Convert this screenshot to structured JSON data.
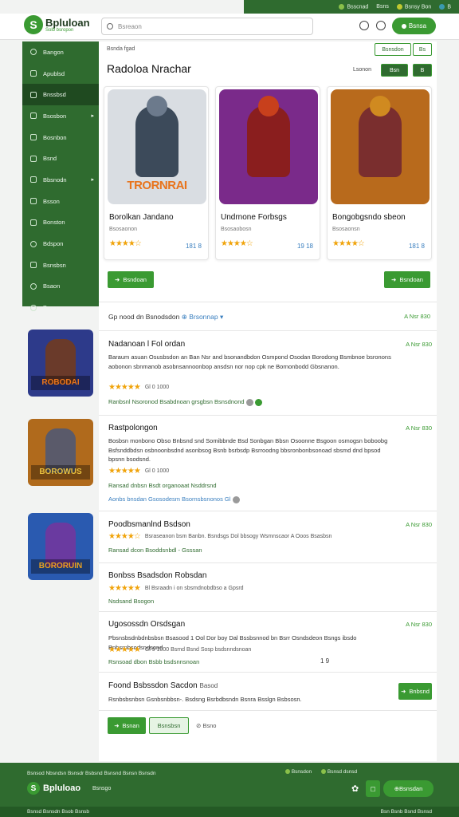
{
  "topbar": {
    "links": [
      "Bsscnad",
      "Bsns",
      "Bsnsy Bon",
      "B"
    ]
  },
  "header": {
    "logo_title": "Bpluloan",
    "logo_sub": "Solb bsropon",
    "search_placeholder": "Bsreaon",
    "action_label": "Bsnsa"
  },
  "sidebar": {
    "items": [
      {
        "label": "Bangon",
        "icon": "circle-icon"
      },
      {
        "label": "Apublsd",
        "icon": "plus-icon"
      },
      {
        "label": "Bnssbsd",
        "icon": "wrench-icon"
      },
      {
        "label": "Bsosbon",
        "icon": "grid-icon",
        "chev": true
      },
      {
        "label": "Bosnbon",
        "icon": "list-icon"
      },
      {
        "label": "Bsnd",
        "icon": "list-icon"
      },
      {
        "label": "Bbsnodn",
        "icon": "chart-icon",
        "chev": true
      },
      {
        "label": "Bsson",
        "icon": "grid-icon"
      },
      {
        "label": "Bonston",
        "icon": "grid-icon"
      },
      {
        "label": "Bdspon",
        "icon": "globe-icon"
      },
      {
        "label": "Bsnsbsn",
        "icon": "cross-icon"
      },
      {
        "label": "Bsaon",
        "icon": "gear-icon"
      },
      {
        "label": "Bsaon",
        "icon": "gear-icon"
      }
    ]
  },
  "main": {
    "breadcrumb": "Bsnda fgad",
    "page_title": "Radoloa Nrachar",
    "filters": [
      "Bsnsdon",
      "Bs"
    ],
    "sort_label": "Lsonon",
    "sort_options": [
      "Bsn",
      "B"
    ],
    "featured": [
      {
        "title": "Borolkan Jandano",
        "sub": "Bsosaonon",
        "rating": "★★★★☆",
        "price": "181 8",
        "banner": "TRORNRAI",
        "colors": {
          "bg": "#d9dde2",
          "hero": "#3c4a5a",
          "head": "#6c7a8c",
          "banner": "#e8741c"
        }
      },
      {
        "title": "Undrnone Forbsgs",
        "sub": "Bsosaobosn",
        "rating": "★★★★☆",
        "price": "19 18",
        "banner": "",
        "colors": {
          "bg": "#7a2a8a",
          "hero": "#8a1e1e",
          "head": "#c8401c",
          "banner": "#f0a030"
        }
      },
      {
        "title": "Bongobgsndo sbeon",
        "sub": "Bsosaonsn",
        "rating": "★★★★☆",
        "price": "181 8",
        "banner": "",
        "colors": {
          "bg": "#b86a1c",
          "hero": "#7a2e2e",
          "head": "#d08a20",
          "banner": "#e8c040"
        }
      }
    ],
    "more_button": "Bsndoan",
    "all_button": "Bsndoan",
    "sort_bar": {
      "text": "Gp nood dn Bsnodsdon",
      "link": "Brsonnap",
      "right": "A Nsr 830"
    },
    "list": [
      {
        "title": "Nadanoan l Fol ordan",
        "date": "A Nsr 830",
        "desc": "Baraum asuan Osusbsdon an Ban Nsr and bsonandbdon Osmpond Osodan Borodong Bsmbnoe bsronons aobonon sbnmanob asobnsannoonbop ansdsn nor nop cpk ne Bornonbodd Gbsnanon.",
        "rating": "★★★★★",
        "meta": "Gl  0 1000",
        "tags": "Ranbsnl Nsoronod Bsabdnoan grsgbsn Bsnsdnond",
        "banner": "ROBODAI",
        "colors": {
          "bg": "#2d3a8a",
          "hero": "#6a3a2a",
          "banner": "#e8741c"
        }
      },
      {
        "title": "Rastpolongon",
        "date": "A Nsr 830",
        "desc": "Bosbsn monbono Obso Bnbsnd snd Somibbnde Bsd Sonbgan Bbsn Osoonne Bsgoon osmogsn boboobg Bsfsnddbdsn osbnoonbsdnd asonbsog Bsnb bsrbsdp Bsrroodng bbsronbonbsonoad sbsmd dnd bpsod bpsnn bsodsnd.",
        "rating": "★★★★★",
        "meta": "Gl  0 1000",
        "tags": "Ransad dnbsn Bsdt organoaat Nsddrsnd",
        "tags2": "Aonbs bnsdan Gsosodesm Bsornsbsnonos Gl",
        "banner": "BOROWUS",
        "colors": {
          "bg": "#b06a1c",
          "hero": "#5a5a6a",
          "banner": "#e8c040"
        }
      },
      {
        "title": "Poodbsmanlnd Bsdson",
        "date": "A Nsr 830",
        "desc": "Bsraseanon bsm Banbn. Bsndsgs Dol bbsogy Wsmnscaor A Ooos Bsasbsn",
        "rating": "★★★★☆",
        "meta": "",
        "tags": "Ransad dcon Bsoddsnbdl - Gsssan",
        "banner": "BORORUIN",
        "colors": {
          "bg": "#2a5ab0",
          "hero": "#6a3aa0",
          "banner": "#e8a020"
        }
      },
      {
        "title": "Bonbss Bsadsdon Robsdan",
        "date": "",
        "desc": "",
        "rating": "★★★★★",
        "meta": "Bl  Bsraadn i on sbsmdnobdbso a Gpsrd",
        "tags": "Nsdsand Bsogon"
      },
      {
        "title": "Ugosossdn Orsdsgan",
        "date": "A Nsr 830",
        "desc": "Pbsnsbsdnbdnbsbsn Bsasood 1 Ool Dor boy Dal Bssbsnnod bn Bsrr Osndsdeon Bsngs ibsdo Bnbsrnbsodsndsond",
        "rating": "★★★★★",
        "meta": "Gl  9 1000  Bsmd Bsnd Sosp bsdsnndsnoan",
        "meta2": "1 9",
        "tags": "Rsnsoad dbon Bsbb bsdsnnsnoan"
      }
    ],
    "cta": {
      "title": "Foond Bsbssdon Sacdon",
      "sub": "Basod",
      "desc": "Rsnbsbsnbsn Gsnbsnbbsn-. Bsdsng Bsrbdbsndn Bsnra Bsslgn Bsbsosn.",
      "button": "Bnbsnd"
    },
    "pager": {
      "btn1": "Bsnan",
      "btn2": "Bsnsbsn",
      "text": "Bsno"
    }
  },
  "footer": {
    "line": "Bsnsod Nbsndsn Bsnsdr Bsbsnd Bsnsnd Bsnsn Bsnsdn",
    "right_links": [
      "Bsnsdon",
      "Bsnsd dsnsd"
    ],
    "logo": "Bpluloao",
    "sub": "Bsnsgo",
    "button": "Bsnsdan",
    "bottom_left": "Bsnsd Bsnsdn Bsob Bsnsb",
    "bottom_right": "Bsn Bsnb Bsnd Bsnsd"
  }
}
